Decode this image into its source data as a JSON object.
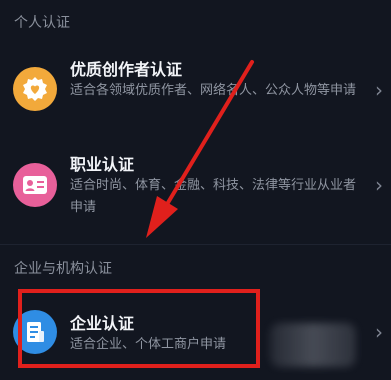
{
  "personal_section": {
    "header": "个人认证",
    "items": [
      {
        "icon": "heart-badge-icon",
        "title": "优质创作者认证",
        "desc": "适合各领域优质作者、网络名人、公众人物等申请"
      },
      {
        "icon": "id-card-icon",
        "title": "职业认证",
        "desc": "适合时尚、体育、金融、科技、法律等行业从业者申请"
      }
    ]
  },
  "org_section": {
    "header": "企业与机构认证",
    "items": [
      {
        "icon": "building-icon",
        "title": "企业认证",
        "desc": "适合企业、个体工商户申请"
      }
    ]
  },
  "chevron": "›",
  "colors": {
    "background": "#121620",
    "creator_icon_bg": "#f2a93b",
    "profession_icon_bg": "#e8609a",
    "enterprise_icon_bg": "#2f8de4",
    "highlight": "#e0201c"
  }
}
